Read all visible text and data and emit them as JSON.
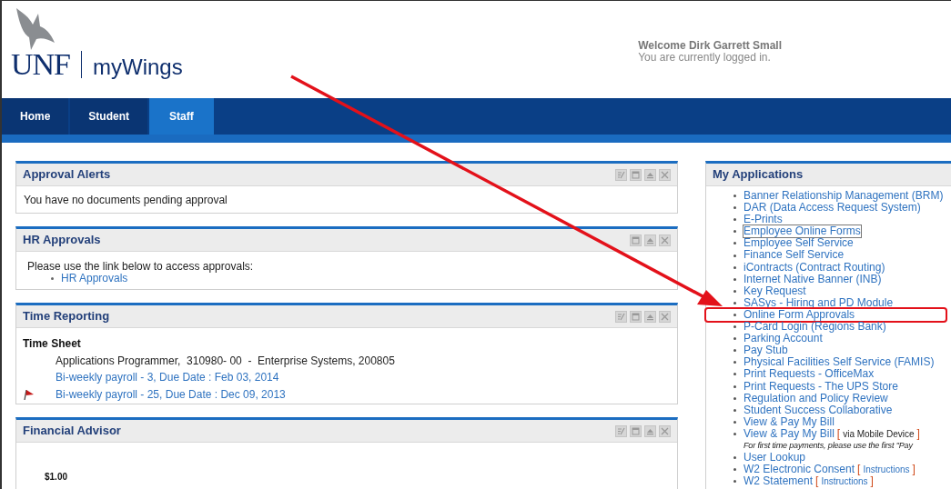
{
  "brand": {
    "short": "UNF",
    "name": "myWings"
  },
  "welcome": {
    "greeting": "Welcome Dirk Garrett Small",
    "status": "You are currently logged in."
  },
  "nav": [
    {
      "label": "Home",
      "selected": false
    },
    {
      "label": "Student",
      "selected": false
    },
    {
      "label": "Staff",
      "selected": true
    }
  ],
  "portlets": [
    {
      "title": "Approval Alerts",
      "editable": true,
      "kind": "message",
      "text": "You have no documents pending approval"
    },
    {
      "title": "HR Approvals",
      "editable": false,
      "kind": "links",
      "text": "Please use the link below to access approvals:",
      "links": [
        "HR Approvals"
      ]
    },
    {
      "title": "Time Reporting",
      "editable": true,
      "kind": "timesheet",
      "heading": "Time Sheet",
      "job": "Applications Programmer,  310980- 00  -  Enterprise Systems, 200805",
      "entries": [
        {
          "label": "Bi-weekly payroll - 3, Due Date : Feb 03, 2014",
          "flagged": false
        },
        {
          "label": "Bi-weekly payroll - 25, Due Date : Dec 09, 2013",
          "flagged": true
        }
      ]
    },
    {
      "title": "Financial Advisor",
      "editable": true,
      "kind": "amount",
      "amount": "$1.00"
    }
  ],
  "applications": {
    "title": "My Applications",
    "items": [
      {
        "label": "Banner Relationship Management (BRM)",
        "focused": false,
        "highlighted": false
      },
      {
        "label": "DAR (Data Access Request System)",
        "focused": false,
        "highlighted": false
      },
      {
        "label": "E-Prints",
        "focused": false,
        "highlighted": false
      },
      {
        "label": "Employee Online Forms",
        "focused": true,
        "highlighted": false
      },
      {
        "label": "Employee Self Service",
        "focused": false,
        "highlighted": false
      },
      {
        "label": "Finance Self Service",
        "focused": false,
        "highlighted": false
      },
      {
        "label": "iContracts (Contract Routing)",
        "focused": false,
        "highlighted": false
      },
      {
        "label": "Internet Native Banner (INB)",
        "focused": false,
        "highlighted": false
      },
      {
        "label": "Key Request",
        "focused": false,
        "highlighted": false
      },
      {
        "label": "SASys - Hiring and PD Module",
        "focused": false,
        "highlighted": false
      },
      {
        "label": "Online Form Approvals",
        "focused": false,
        "highlighted": true
      },
      {
        "label": "P-Card Login (Regions Bank)",
        "focused": false,
        "highlighted": false
      },
      {
        "label": "Parking Account",
        "focused": false,
        "highlighted": false
      },
      {
        "label": "Pay Stub",
        "focused": false,
        "highlighted": false
      },
      {
        "label": "Physical Facilities Self Service (FAMIS)",
        "focused": false,
        "highlighted": false
      },
      {
        "label": "Print Requests - OfficeMax",
        "focused": false,
        "highlighted": false
      },
      {
        "label": "Print Requests - The UPS Store",
        "focused": false,
        "highlighted": false
      },
      {
        "label": "Regulation and Policy Review",
        "focused": false,
        "highlighted": false
      },
      {
        "label": "Student Success Collaborative",
        "focused": false,
        "highlighted": false
      },
      {
        "label": "View & Pay My Bill",
        "focused": false,
        "highlighted": false
      },
      {
        "label": "View & Pay My Bill",
        "focused": false,
        "highlighted": false,
        "suffix": {
          "open": "[",
          "text": "via Mobile Device",
          "close": "]",
          "kind": "text"
        },
        "note": "For first time payments, please use the first \"Pay"
      },
      {
        "label": "User Lookup",
        "focused": false,
        "highlighted": false
      },
      {
        "label": "W2 Electronic Consent",
        "focused": false,
        "highlighted": false,
        "suffix": {
          "open": "[",
          "text": "Instructions",
          "close": "]",
          "kind": "link"
        }
      },
      {
        "label": "W2 Statement",
        "focused": false,
        "highlighted": false,
        "suffix": {
          "open": "[",
          "text": "Instructions",
          "close": "]",
          "kind": "link"
        }
      }
    ]
  }
}
